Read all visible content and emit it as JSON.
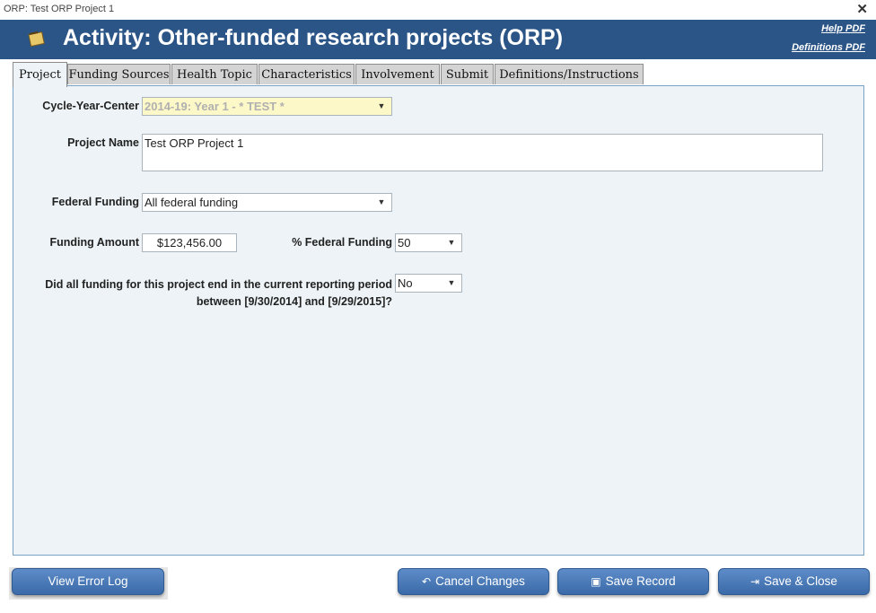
{
  "window": {
    "title": "ORP: Test ORP Project 1",
    "close_glyph": "✕"
  },
  "header": {
    "title": "Activity: Other-funded research projects (ORP)",
    "help_link": "Help PDF",
    "definitions_link": "Definitions PDF",
    "logo_icon": "sticky-note-icon"
  },
  "tabs": [
    {
      "label": "Project",
      "active": true
    },
    {
      "label": "Funding Sources"
    },
    {
      "label": "Health Topic"
    },
    {
      "label": "Characteristics"
    },
    {
      "label": "Involvement"
    },
    {
      "label": "Submit"
    },
    {
      "label": "Definitions/Instructions"
    }
  ],
  "form": {
    "cycle": {
      "label": "Cycle-Year-Center",
      "value": "2014-19: Year 1 - * TEST *"
    },
    "project_name": {
      "label": "Project Name",
      "value": "Test ORP Project 1"
    },
    "federal_funding": {
      "label": "Federal Funding",
      "value": "All federal funding"
    },
    "funding_amount": {
      "label": "Funding Amount",
      "value": "$123,456.00"
    },
    "pct_federal": {
      "label": "% Federal Funding",
      "value": "50"
    },
    "funding_end": {
      "label_line1": "Did all funding for this project end in the current reporting period",
      "label_line2": "between [9/30/2014] and [9/29/2015]?",
      "value": "No"
    }
  },
  "buttons": {
    "view_error_log": "View Error Log",
    "cancel_changes": "Cancel Changes",
    "save_record": "Save Record",
    "save_close": "Save & Close"
  },
  "colors": {
    "header_bg": "#2b5587",
    "panel_bg": "#edf3f6",
    "button_bg": "#4a7bbd",
    "cycle_bg": "#fdf8c7"
  }
}
